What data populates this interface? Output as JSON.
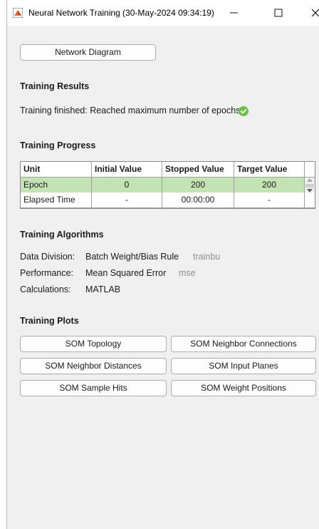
{
  "window": {
    "title": "Neural Network Training (30-May-2024 09:34:19)",
    "minimize_glyph": "—",
    "maximize_glyph": "☐",
    "close_glyph": "✕",
    "app_icon": "matlab-icon"
  },
  "network_diagram_label": "Network Diagram",
  "training_results": {
    "title": "Training Results",
    "status_text": "Training finished: Reached maximum number of epochs",
    "status_icon": "check-circle-icon",
    "status_color": "#6cc04a"
  },
  "training_progress": {
    "title": "Training Progress",
    "columns": [
      "Unit",
      "Initial Value",
      "Stopped Value",
      "Target Value"
    ],
    "rows": [
      {
        "unit": "Epoch",
        "initial": "0",
        "stopped": "200",
        "target": "200"
      },
      {
        "unit": "Elapsed Time",
        "initial": "-",
        "stopped": "00:00:00",
        "target": "-"
      }
    ],
    "highlight_color": "#c4e3b5"
  },
  "training_algorithms": {
    "title": "Training Algorithms",
    "items": [
      {
        "label": "Data Division:",
        "value": "Batch Weight/Bias Rule",
        "code": "trainbu"
      },
      {
        "label": "Performance:",
        "value": "Mean Squared Error",
        "code": "mse"
      },
      {
        "label": "Calculations:",
        "value": "MATLAB",
        "code": ""
      }
    ]
  },
  "training_plots": {
    "title": "Training Plots",
    "buttons": [
      "SOM Topology",
      "SOM Neighbor Connections",
      "SOM Neighbor Distances",
      "SOM Input Planes",
      "SOM Sample Hits",
      "SOM Weight Positions"
    ]
  }
}
